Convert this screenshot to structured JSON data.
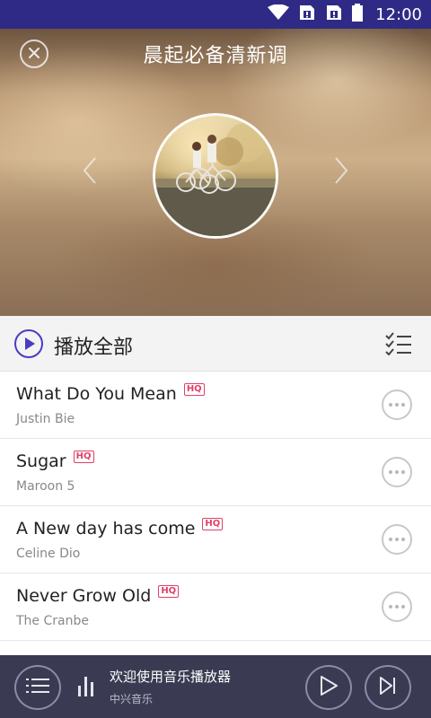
{
  "status_bar": {
    "time": "12:00",
    "icons": [
      "wifi-icon",
      "sim1-icon",
      "sim2-icon",
      "battery-icon"
    ],
    "background": "#2f2a86"
  },
  "header": {
    "title": "晨起必备清新调",
    "close_icon": "close-icon",
    "prev_icon": "chevron-left-icon",
    "next_icon": "chevron-right-icon"
  },
  "play_all": {
    "label": "播放全部",
    "icon": "play-circle-icon",
    "accent": "#4b3dc0",
    "multiselect_icon": "multi-select-icon"
  },
  "songs": [
    {
      "title": "What Do You Mean",
      "artist": "Justin Bie",
      "badge": "HQ"
    },
    {
      "title": "Sugar",
      "artist": "Maroon 5",
      "badge": "HQ"
    },
    {
      "title": "A New day has come",
      "artist": "Celine Dio",
      "badge": "HQ"
    },
    {
      "title": "Never Grow Old",
      "artist": "The Cranbe",
      "badge": "HQ"
    }
  ],
  "player": {
    "title": "欢迎使用音乐播放器",
    "subtitle": "中兴音乐",
    "icons": [
      "playlist-icon",
      "equalizer-icon",
      "play-icon",
      "next-track-icon"
    ],
    "background": "#3a3b52"
  },
  "colors": {
    "hq_badge": "#e0406a"
  }
}
